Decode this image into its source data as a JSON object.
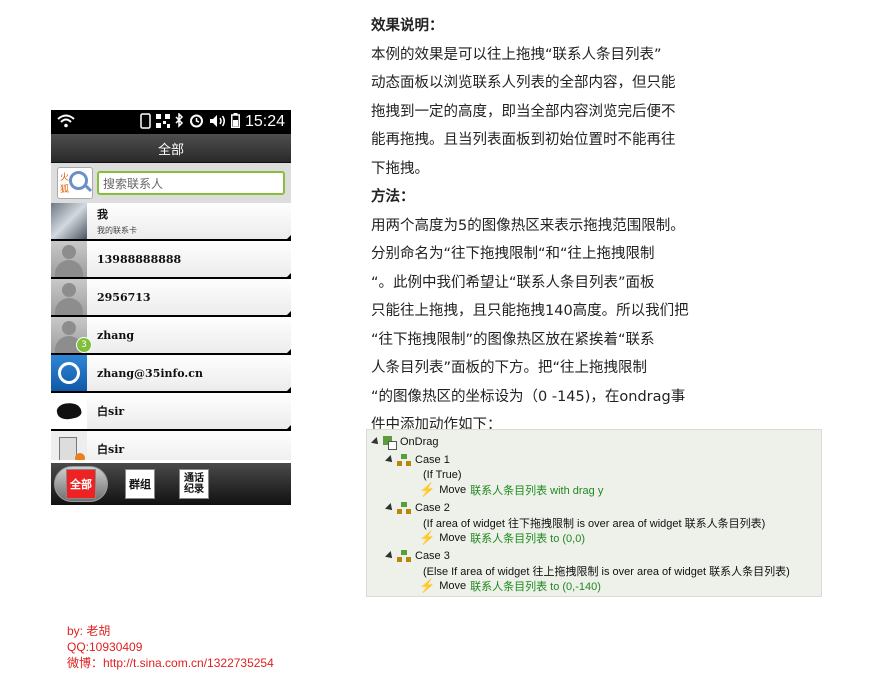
{
  "phone": {
    "status_time": "15:24",
    "title": "全部",
    "search_logo_text_1": "火",
    "search_logo_text_2": "狐",
    "search_placeholder": "搜索联系人",
    "contacts": [
      {
        "name": "我",
        "sub": "我的联系卡"
      },
      {
        "name": "13988888888"
      },
      {
        "name": "2956713"
      },
      {
        "name": "zhang",
        "badge": "3"
      },
      {
        "name": "zhang@35info.cn"
      },
      {
        "name": "白sir"
      },
      {
        "name": "白sir"
      }
    ],
    "tabs": {
      "all": "全部",
      "group": "群组",
      "calls": "通话\n纪录"
    }
  },
  "description": {
    "lines": [
      "效果说明：",
      "本例的效果是可以往上拖拽“联系人条目列表”",
      "动态面板以浏览联系人列表的全部内容，但只能",
      "拖拽到一定的高度，即当全部内容浏览完后便不",
      "能再拖拽。且当列表面板到初始位置时不能再往",
      "下拖拽。",
      "方法：",
      "用两个高度为5的图像热区来表示拖拽范围限制。",
      "分别命名为“往下拖拽限制“和“往上拖拽限制",
      "“。此例中我们希望让“联系人条目列表”面板",
      "只能往上拖拽，且只能拖拽140高度。所以我们把",
      "“往下拖拽限制”的图像热区放在紧挨着“联系",
      "人条目列表”面板的下方。把“往上拖拽限制",
      "“的图像热区的坐标设为（0 -145)，在ondrag事",
      "件中添加动作如下："
    ]
  },
  "event_panel": {
    "event": "OnDrag",
    "cases": [
      {
        "name": "Case 1",
        "condition": "(If True)",
        "action_prefix": "Move",
        "action_target": "联系人条目列表 with drag y"
      },
      {
        "name": "Case 2",
        "condition": "(If area of widget 往下拖拽限制 is over area of widget 联系人条目列表)",
        "action_prefix": "Move",
        "action_target": "联系人条目列表 to (0,0)"
      },
      {
        "name": "Case 3",
        "condition": "(Else If area of widget 往上拖拽限制 is over area of widget 联系人条目列表)",
        "action_prefix": "Move",
        "action_target": "联系人条目列表 to (0,-140)"
      }
    ]
  },
  "credits": {
    "by": "by: 老胡",
    "qq": "QQ:10930409",
    "weibo": "微博：http://t.sina.com.cn/1322735254"
  }
}
